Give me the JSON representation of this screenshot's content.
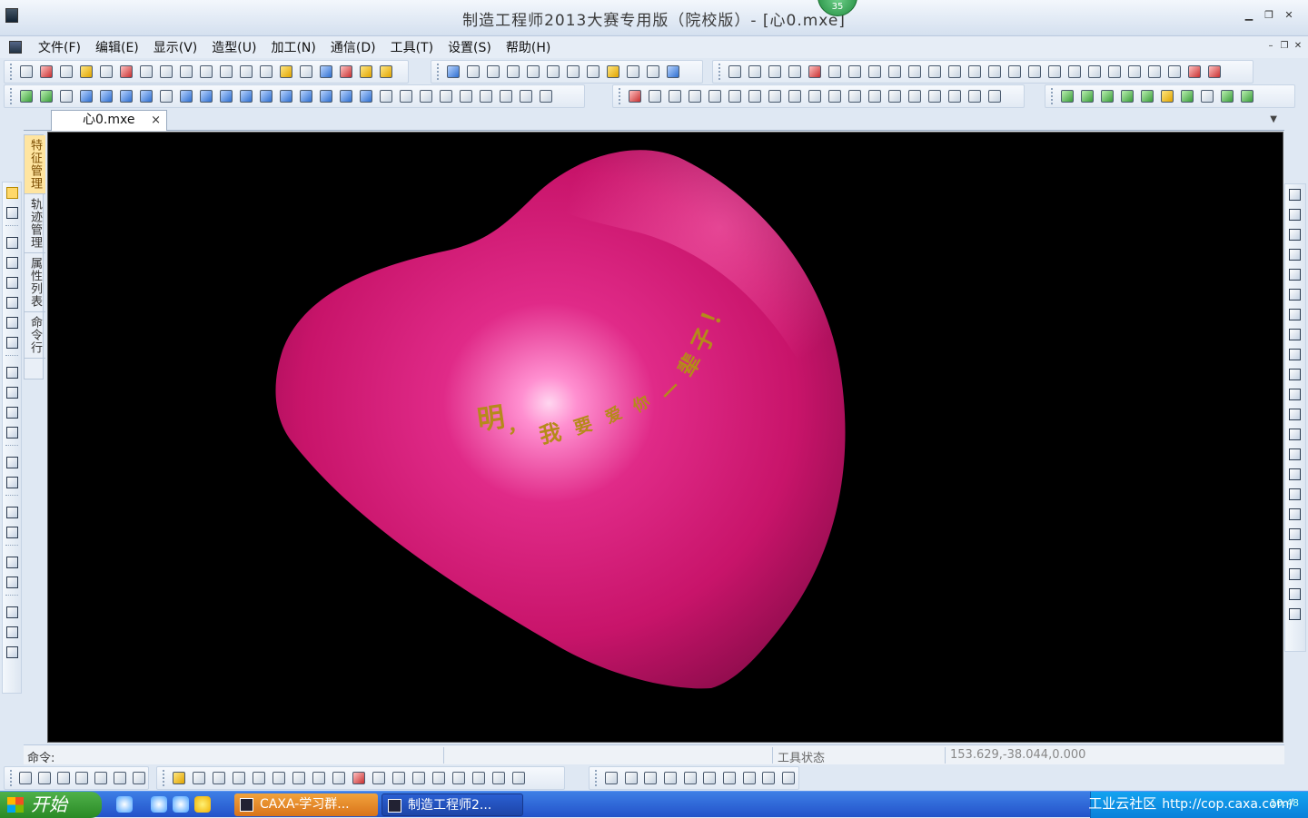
{
  "window": {
    "title": "制造工程师2013大赛专用版（院校版）- [心0.mxe]",
    "badge": "35"
  },
  "menu": [
    "文件(F)",
    "编辑(E)",
    "显示(V)",
    "造型(U)",
    "加工(N)",
    "通信(D)",
    "工具(T)",
    "设置(S)",
    "帮助(H)"
  ],
  "document_tab": {
    "label": "心0.mxe",
    "close": "×"
  },
  "side_tabs": [
    "特征管理",
    "轨迹管理",
    "属性列表",
    "命令行"
  ],
  "model": {
    "engraved_text": [
      "明",
      "，",
      "我",
      "要",
      "爱",
      "你",
      "一",
      "辈",
      "子",
      "！"
    ],
    "colors": {
      "heart_base": "#c8146a",
      "heart_highlight": "#ff8fd0",
      "text": "#b58a1a",
      "background": "#000000"
    }
  },
  "status": {
    "command_label": "命令:",
    "tool_state": "工具状态",
    "coordinates": "153.629,-38.044,0.000"
  },
  "taskbar": {
    "start": "开始",
    "tasks": [
      {
        "label": "CAXA-学习群..."
      },
      {
        "label": "制造工程师2..."
      }
    ],
    "watermark": "工业云社区",
    "watermark_url": "http://cop.caxa.com/",
    "clock": "10:48"
  }
}
